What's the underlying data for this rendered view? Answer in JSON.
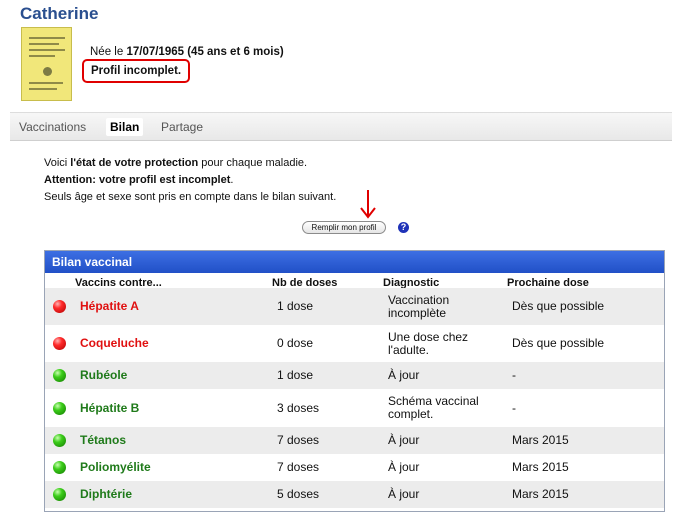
{
  "header": {
    "name": "Catherine",
    "birth_prefix": "Née le",
    "birth_date": "17/07/1965",
    "birth_age": "(45 ans et 6 mois)",
    "profile_status": "Profil incomplet."
  },
  "tabs": [
    {
      "label": "Vaccinations",
      "active": false
    },
    {
      "label": "Bilan",
      "active": true
    },
    {
      "label": "Partage",
      "active": false
    }
  ],
  "intro": {
    "line1_pre": "Voici ",
    "line1_bold": "l'état de votre protection",
    "line1_post": " pour chaque maladie.",
    "line2_bold": "Attention: votre profil est incomplet",
    "line2_post": ".",
    "line3": "Seuls âge et sexe sont pris en compte dans le bilan suivant."
  },
  "actions": {
    "fill_profile_label": "Remplir mon profil",
    "help_label": "?"
  },
  "panel": {
    "title": "Bilan vaccinal",
    "columns": [
      "Vaccins contre...",
      "Nb de doses",
      "Diagnostic",
      "Prochaine dose"
    ]
  },
  "rows": [
    {
      "status": "red",
      "vaccine": "Hépatite A",
      "doses": "1 dose",
      "diag1": "Vaccination",
      "diag2": "incomplète",
      "next": "Dès que possible"
    },
    {
      "status": "red",
      "vaccine": "Coqueluche",
      "doses": "0 dose",
      "diag1": "Une dose chez",
      "diag2": "l'adulte.",
      "next": "Dès que possible"
    },
    {
      "status": "green",
      "vaccine": "Rubéole",
      "doses": "1 dose",
      "diag1": "À jour",
      "diag2": "",
      "next": "-"
    },
    {
      "status": "green",
      "vaccine": "Hépatite B",
      "doses": "3 doses",
      "diag1": "Schéma vaccinal",
      "diag2": "complet.",
      "next": "-"
    },
    {
      "status": "green",
      "vaccine": "Tétanos",
      "doses": "7 doses",
      "diag1": "À jour",
      "diag2": "",
      "next": "Mars 2015"
    },
    {
      "status": "green",
      "vaccine": "Poliomyélite",
      "doses": "7 doses",
      "diag1": "À jour",
      "diag2": "",
      "next": "Mars 2015"
    },
    {
      "status": "green",
      "vaccine": "Diphtérie",
      "doses": "5 doses",
      "diag1": "À jour",
      "diag2": "",
      "next": "Mars 2015"
    }
  ],
  "colors": {
    "name": "#2a4f8f",
    "panel_header": "#2150c7",
    "row_alt": "#ececec",
    "status_red": "#e01010",
    "status_green": "#1f7a1a",
    "highlight_border": "#e00000"
  }
}
